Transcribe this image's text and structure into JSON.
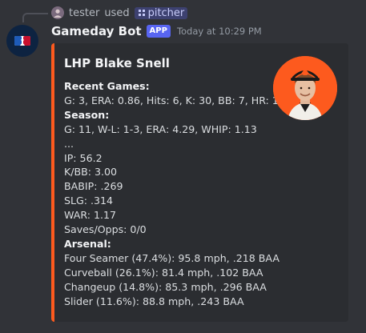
{
  "reply": {
    "user": "tester",
    "used_text": "used",
    "command": "pitcher"
  },
  "message": {
    "author": "Gameday Bot",
    "badge": "APP",
    "timestamp": "Today at 10:29 PM"
  },
  "embed": {
    "accent_color": "#fd5a1e",
    "title": "LHP Blake Snell",
    "recent_games_label": "Recent Games:",
    "recent_games_line": "G: 3, ERA: 0.86, Hits: 6, K: 30, BB: 7, HR: 1",
    "season_label": "Season:",
    "season_lines": [
      "G: 11, W-L: 1-3, ERA: 4.29, WHIP: 1.13",
      "...",
      "IP: 56.2",
      "K/BB: 3.00",
      "BABIP: .269",
      "SLG: .314",
      "WAR: 1.17",
      "Saves/Opps: 0/0"
    ],
    "arsenal_label": "Arsenal:",
    "arsenal_lines": [
      "Four Seamer (47.4%): 95.8 mph, .218 BAA",
      "Curveball (26.1%): 81.4 mph, .102 BAA",
      "Changeup (14.8%): 85.3 mph, .296 BAA",
      "Slider (11.6%): 88.8 mph, .243 BAA"
    ],
    "thumbnail_icon": "player-headshot-icon"
  }
}
